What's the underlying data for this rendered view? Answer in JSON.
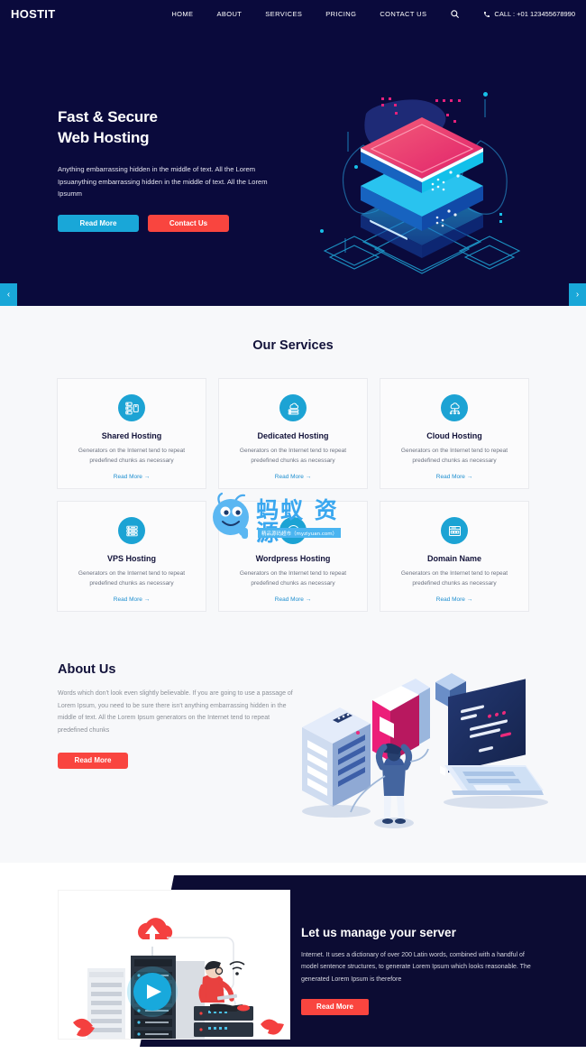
{
  "header": {
    "logo": "HOSTIT",
    "nav": [
      {
        "label": "HOME"
      },
      {
        "label": "ABOUT"
      },
      {
        "label": "SERVICES"
      },
      {
        "label": "PRICING"
      },
      {
        "label": "CONTACT US"
      }
    ],
    "search_icon": "search-icon",
    "phone_icon": "phone-icon",
    "phone": "CALL : +01 123455678990"
  },
  "hero": {
    "title_line1": "Fast & Secure",
    "title_line2": "Web Hosting",
    "paragraph": "Anything embarrassing hidden in the middle of text. All the Lorem Ipsuanything embarrassing hidden in the middle of text. All the Lorem Ipsumm",
    "primary_button": "Read More",
    "secondary_button": "Contact Us",
    "prev_arrow": "‹",
    "next_arrow": "›",
    "illustration": "isometric-server-stack-illustration"
  },
  "services": {
    "title": "Our Services",
    "cards": [
      {
        "icon": "shared-hosting-icon",
        "title": "Shared Hosting",
        "text": "Generators on the Internet tend to repeat predefined chunks as necessary",
        "link": "Read More →"
      },
      {
        "icon": "dedicated-hosting-icon",
        "title": "Dedicated Hosting",
        "text": "Generators on the Internet tend to repeat predefined chunks as necessary",
        "link": "Read More →"
      },
      {
        "icon": "cloud-hosting-icon",
        "title": "Cloud Hosting",
        "text": "Generators on the Internet tend to repeat predefined chunks as necessary",
        "link": "Read More →"
      },
      {
        "icon": "vps-hosting-icon",
        "title": "VPS Hosting",
        "text": "Generators on the Internet tend to repeat predefined chunks as necessary",
        "link": "Read More →"
      },
      {
        "icon": "wordpress-hosting-icon",
        "title": "Wordpress Hosting",
        "text": "Generators on the Internet tend to repeat predefined chunks as necessary",
        "link": "Read More →"
      },
      {
        "icon": "domain-name-icon",
        "title": "Domain Name",
        "text": "Generators on the Internet tend to repeat predefined chunks as necessary",
        "link": "Read More →"
      }
    ]
  },
  "about": {
    "title": "About Us",
    "paragraph": "Words which don't look even slightly believable. If you are going to use a passage of Lorem Ipsum, you need to be sure there isn't anything embarrassing hidden in the middle of text. All the Lorem Ipsum generators on the Internet tend to repeat predefined chunks",
    "button": "Read More",
    "illustration": "isometric-laptop-server-person-illustration"
  },
  "manage": {
    "title": "Let us manage your server",
    "paragraph": "Internet. It uses a dictionary of over 200 Latin words, combined with a handful of model sentence structures, to generate Lorem Ipsum which looks reasonable. The generated Lorem Ipsum is therefore",
    "button": "Read More",
    "illustration": "datacenter-person-video-illustration"
  },
  "watermark": {
    "text": "蚂蚁 资源",
    "subtitle": "精品源码超市（myziyuan.com）"
  },
  "colors": {
    "dark_navy": "#0a0a3c",
    "blue": "#19a7d8",
    "red": "#f9453f",
    "pink": "#ec2a7b",
    "light_bg": "#f7f8fa"
  }
}
